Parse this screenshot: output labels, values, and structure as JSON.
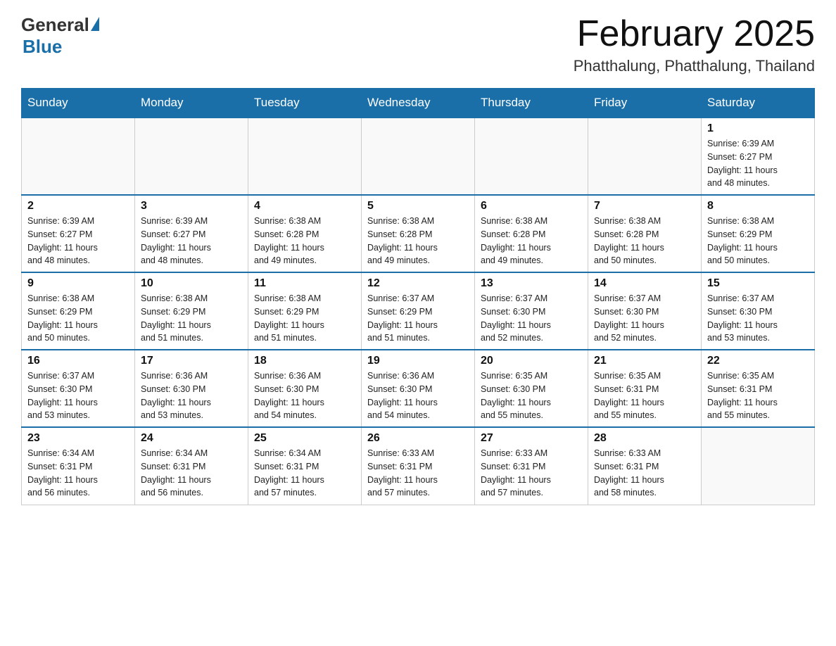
{
  "header": {
    "logo_general": "General",
    "logo_blue": "Blue",
    "month_title": "February 2025",
    "location": "Phatthalung, Phatthalung, Thailand"
  },
  "weekdays": [
    "Sunday",
    "Monday",
    "Tuesday",
    "Wednesday",
    "Thursday",
    "Friday",
    "Saturday"
  ],
  "weeks": [
    [
      {
        "day": "",
        "info": ""
      },
      {
        "day": "",
        "info": ""
      },
      {
        "day": "",
        "info": ""
      },
      {
        "day": "",
        "info": ""
      },
      {
        "day": "",
        "info": ""
      },
      {
        "day": "",
        "info": ""
      },
      {
        "day": "1",
        "info": "Sunrise: 6:39 AM\nSunset: 6:27 PM\nDaylight: 11 hours\nand 48 minutes."
      }
    ],
    [
      {
        "day": "2",
        "info": "Sunrise: 6:39 AM\nSunset: 6:27 PM\nDaylight: 11 hours\nand 48 minutes."
      },
      {
        "day": "3",
        "info": "Sunrise: 6:39 AM\nSunset: 6:27 PM\nDaylight: 11 hours\nand 48 minutes."
      },
      {
        "day": "4",
        "info": "Sunrise: 6:38 AM\nSunset: 6:28 PM\nDaylight: 11 hours\nand 49 minutes."
      },
      {
        "day": "5",
        "info": "Sunrise: 6:38 AM\nSunset: 6:28 PM\nDaylight: 11 hours\nand 49 minutes."
      },
      {
        "day": "6",
        "info": "Sunrise: 6:38 AM\nSunset: 6:28 PM\nDaylight: 11 hours\nand 49 minutes."
      },
      {
        "day": "7",
        "info": "Sunrise: 6:38 AM\nSunset: 6:28 PM\nDaylight: 11 hours\nand 50 minutes."
      },
      {
        "day": "8",
        "info": "Sunrise: 6:38 AM\nSunset: 6:29 PM\nDaylight: 11 hours\nand 50 minutes."
      }
    ],
    [
      {
        "day": "9",
        "info": "Sunrise: 6:38 AM\nSunset: 6:29 PM\nDaylight: 11 hours\nand 50 minutes."
      },
      {
        "day": "10",
        "info": "Sunrise: 6:38 AM\nSunset: 6:29 PM\nDaylight: 11 hours\nand 51 minutes."
      },
      {
        "day": "11",
        "info": "Sunrise: 6:38 AM\nSunset: 6:29 PM\nDaylight: 11 hours\nand 51 minutes."
      },
      {
        "day": "12",
        "info": "Sunrise: 6:37 AM\nSunset: 6:29 PM\nDaylight: 11 hours\nand 51 minutes."
      },
      {
        "day": "13",
        "info": "Sunrise: 6:37 AM\nSunset: 6:30 PM\nDaylight: 11 hours\nand 52 minutes."
      },
      {
        "day": "14",
        "info": "Sunrise: 6:37 AM\nSunset: 6:30 PM\nDaylight: 11 hours\nand 52 minutes."
      },
      {
        "day": "15",
        "info": "Sunrise: 6:37 AM\nSunset: 6:30 PM\nDaylight: 11 hours\nand 53 minutes."
      }
    ],
    [
      {
        "day": "16",
        "info": "Sunrise: 6:37 AM\nSunset: 6:30 PM\nDaylight: 11 hours\nand 53 minutes."
      },
      {
        "day": "17",
        "info": "Sunrise: 6:36 AM\nSunset: 6:30 PM\nDaylight: 11 hours\nand 53 minutes."
      },
      {
        "day": "18",
        "info": "Sunrise: 6:36 AM\nSunset: 6:30 PM\nDaylight: 11 hours\nand 54 minutes."
      },
      {
        "day": "19",
        "info": "Sunrise: 6:36 AM\nSunset: 6:30 PM\nDaylight: 11 hours\nand 54 minutes."
      },
      {
        "day": "20",
        "info": "Sunrise: 6:35 AM\nSunset: 6:30 PM\nDaylight: 11 hours\nand 55 minutes."
      },
      {
        "day": "21",
        "info": "Sunrise: 6:35 AM\nSunset: 6:31 PM\nDaylight: 11 hours\nand 55 minutes."
      },
      {
        "day": "22",
        "info": "Sunrise: 6:35 AM\nSunset: 6:31 PM\nDaylight: 11 hours\nand 55 minutes."
      }
    ],
    [
      {
        "day": "23",
        "info": "Sunrise: 6:34 AM\nSunset: 6:31 PM\nDaylight: 11 hours\nand 56 minutes."
      },
      {
        "day": "24",
        "info": "Sunrise: 6:34 AM\nSunset: 6:31 PM\nDaylight: 11 hours\nand 56 minutes."
      },
      {
        "day": "25",
        "info": "Sunrise: 6:34 AM\nSunset: 6:31 PM\nDaylight: 11 hours\nand 57 minutes."
      },
      {
        "day": "26",
        "info": "Sunrise: 6:33 AM\nSunset: 6:31 PM\nDaylight: 11 hours\nand 57 minutes."
      },
      {
        "day": "27",
        "info": "Sunrise: 6:33 AM\nSunset: 6:31 PM\nDaylight: 11 hours\nand 57 minutes."
      },
      {
        "day": "28",
        "info": "Sunrise: 6:33 AM\nSunset: 6:31 PM\nDaylight: 11 hours\nand 58 minutes."
      },
      {
        "day": "",
        "info": ""
      }
    ]
  ]
}
